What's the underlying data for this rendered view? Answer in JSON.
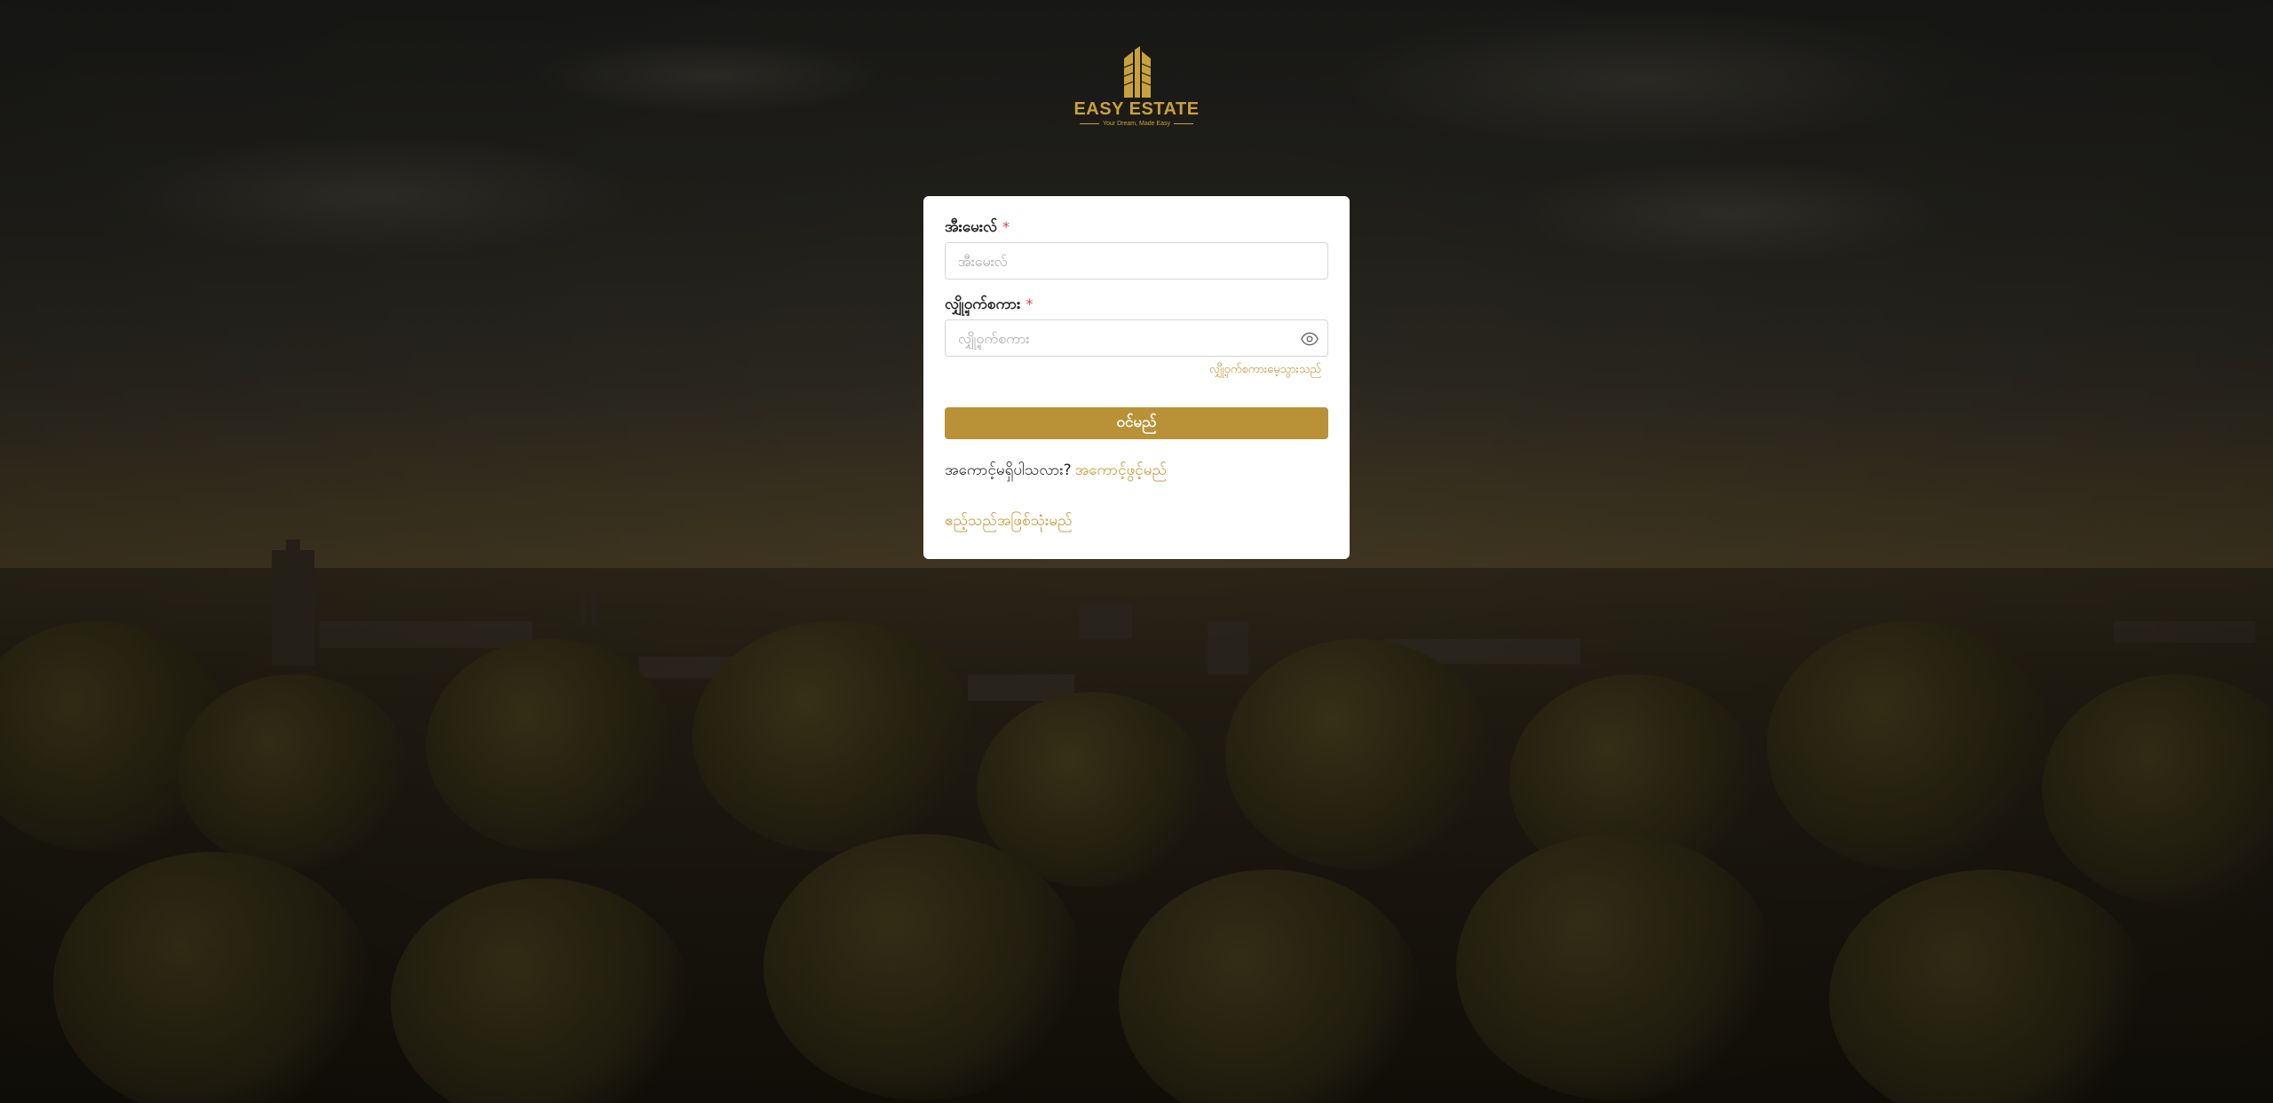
{
  "brand": {
    "name": "EASY ESTATE",
    "tagline": "Your Dream, Made Easy",
    "accent_color": "#c9a13a"
  },
  "login_form": {
    "email": {
      "label": "အီးမေးလ်",
      "required_mark": "*",
      "placeholder": "အီးမေးလ်",
      "value": ""
    },
    "password": {
      "label": "လျှို့ဝှက်စကား",
      "required_mark": "*",
      "placeholder": "လျှို့ဝှက်စကား",
      "value": "",
      "toggle_icon": "eye-icon"
    },
    "forgot_password_link": "လျှို့ဝှက်စကားမေ့သွားသည်",
    "submit_label": "ဝင်မည်",
    "button_color": "#b99238",
    "signup_prompt": "အကောင့်မရှိပါသလား?",
    "signup_link": "အကောင့်ဖွင့်မည်",
    "guest_link": "ဧည့်သည်အဖြစ်သုံးမည်",
    "link_color": "#c4942d"
  }
}
